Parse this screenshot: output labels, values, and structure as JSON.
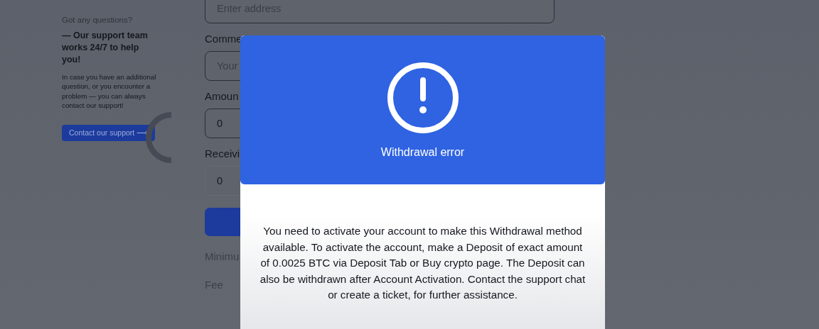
{
  "support": {
    "heading": "Got any questions?",
    "tagline": "— Our support team works 24/7 to help you!",
    "text": "In case you have an additional question, or you encounter a problem — you can always contact our support!",
    "button": "Contact our support ⟶"
  },
  "form": {
    "fields": [
      {
        "kind": "input",
        "placeholder": "Enter address"
      },
      {
        "kind": "input",
        "label": "Comme",
        "placeholder": "Your"
      },
      {
        "kind": "input",
        "label": "Amoun",
        "value": "0"
      },
      {
        "kind": "readonly",
        "label": "Receivi",
        "value": "0"
      },
      {
        "kind": "submit"
      },
      {
        "kind": "info",
        "label": "Minimu"
      },
      {
        "kind": "info",
        "label": "Fee"
      }
    ]
  },
  "modal": {
    "title": "Withdrawal error",
    "message": "You need to activate your account to make this Withdrawal method available. To activate the account, make a Deposit of exact amount of 0.0025 BTC via Deposit Tab or Buy crypto page. The Deposit can also be withdrawn after Account Activation. Contact the support chat or create a ticket, for further assistance."
  }
}
